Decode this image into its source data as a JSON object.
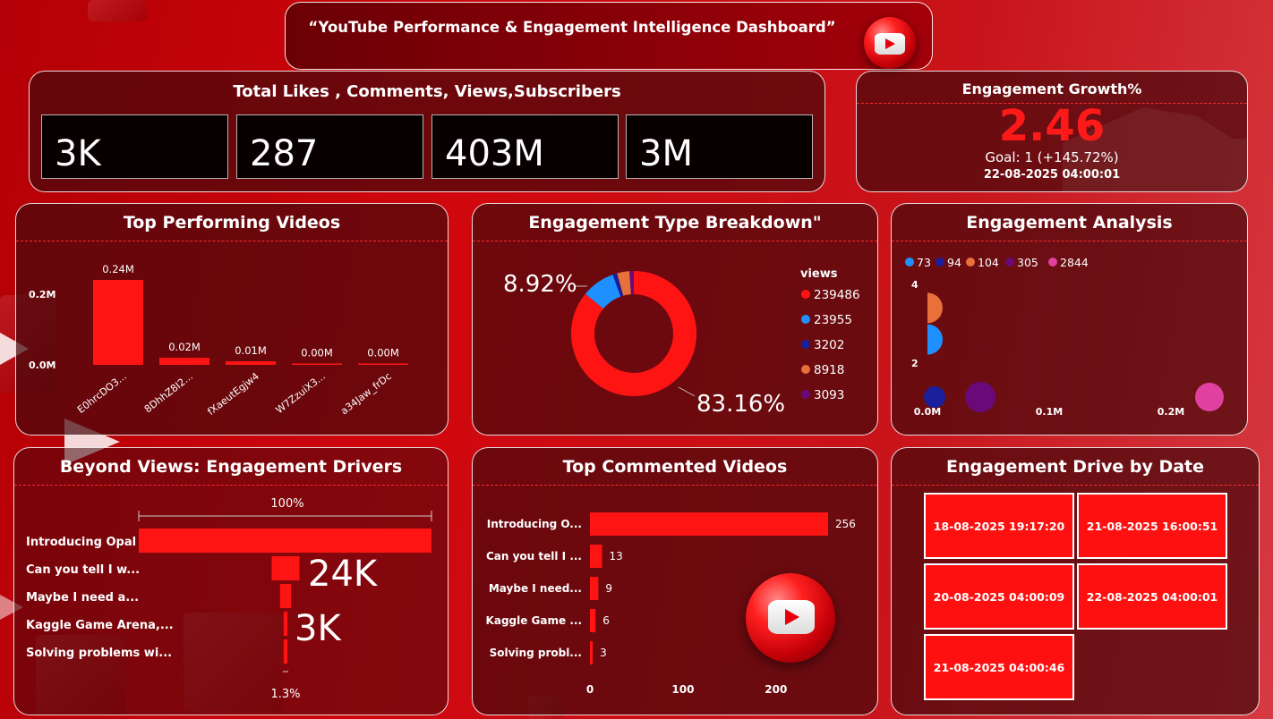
{
  "header": {
    "title": "“YouTube Performance & Engagement Intelligence Dashboard”"
  },
  "kpis": {
    "title": "Total Likes , Comments, Views,Subscribers",
    "values": [
      "3K",
      "287",
      "403M",
      "3M"
    ]
  },
  "growth": {
    "title": "Engagement Growth%",
    "value": "2.46",
    "goal": "Goal: 1 (+145.72%)",
    "timestamp": "22-08-2025 04:00:01"
  },
  "top_performing": {
    "title": "Top Performing Videos"
  },
  "engagement_type": {
    "title": "Engagement Type Breakdown\"",
    "legend_title": "views"
  },
  "engagement_analysis": {
    "title": "Engagement Analysis"
  },
  "beyond_views": {
    "title": "Beyond Views: Engagement Drivers"
  },
  "top_commented": {
    "title": "Top Commented Videos"
  },
  "by_date": {
    "title": "Engagement Drive by Date",
    "dates": [
      "18-08-2025 19:17:20",
      "21-08-2025 16:00:51",
      "20-08-2025 04:00:09",
      "22-08-2025 04:00:01",
      "21-08-2025 04:00:46"
    ]
  },
  "colors": {
    "accent": "#ff1010",
    "panel": "#46080c",
    "blue": "#1e90ff",
    "navy": "#1a1f9c",
    "orange": "#e8703a",
    "purple": "#6a0a7a",
    "pink": "#e040a0"
  },
  "chart_data": [
    {
      "type": "bar",
      "id": "top_performing",
      "categories": [
        "E0hrcDO3...",
        "8DhhZ8I2...",
        "fXaeutEgjw4",
        "W7ZzuiX3...",
        "a34Jaw_frDc"
      ],
      "values": [
        0.24,
        0.02,
        0.01,
        0.0,
        0.0
      ],
      "data_labels": [
        "0.24M",
        "0.02M",
        "0.01M",
        "0.00M",
        "0.00M"
      ],
      "ytick_labels": [
        "0.0M",
        "0.2M"
      ],
      "ylim": [
        0,
        0.24
      ]
    },
    {
      "type": "pie",
      "id": "engagement_type",
      "legend_title": "views",
      "labels": [
        "239486",
        "23955",
        "3202",
        "8918",
        "3093"
      ],
      "values": [
        239486,
        23955,
        3202,
        8918,
        3093
      ],
      "colors": [
        "#ff1414",
        "#1e90ff",
        "#1a1f9c",
        "#e8703a",
        "#6a0a7a"
      ],
      "data_labels": [
        "83.16%",
        "8.92%"
      ]
    },
    {
      "type": "scatter",
      "id": "engagement_analysis",
      "legend": [
        "73",
        "94",
        "104",
        "305",
        "2844"
      ],
      "colors": [
        "#1e90ff",
        "#1a1f9c",
        "#e8703a",
        "#6a0a7a",
        "#e040a0"
      ],
      "points": [
        {
          "series": "73",
          "x": 0.0,
          "y": 2.6
        },
        {
          "series": "94",
          "x": 0.0,
          "y": 1.0
        },
        {
          "series": "104",
          "x": 0.0,
          "y": 3.4
        },
        {
          "series": "305",
          "x": 0.02,
          "y": 1.0
        },
        {
          "series": "2844",
          "x": 0.24,
          "y": 1.0
        }
      ],
      "xtick_labels": [
        "0.0M",
        "0.1M",
        "0.2M"
      ],
      "ytick_labels": [
        "2",
        "4"
      ],
      "xlim": [
        0,
        0.2
      ],
      "ylim": [
        1,
        4
      ]
    },
    {
      "type": "bar",
      "id": "beyond_views",
      "orientation": "funnel",
      "categories": [
        "Introducing Opal",
        "Can you tell I w...",
        "Maybe I need a...",
        "Kaggle Game Arena,...",
        "Solving problems wi..."
      ],
      "values": [
        100,
        9.5,
        3.8,
        1.3,
        1.3
      ],
      "top_label": "100%",
      "bottom_label": "1.3%",
      "annotations": [
        "24K",
        "3K"
      ]
    },
    {
      "type": "bar",
      "id": "top_commented",
      "orientation": "horizontal",
      "categories": [
        "Introducing O...",
        "Can you tell I ...",
        "Maybe I need...",
        "Kaggle Game ...",
        "Solving probl..."
      ],
      "values": [
        256,
        13,
        9,
        6,
        3
      ],
      "xtick_labels": [
        "0",
        "100",
        "200"
      ],
      "xlim": [
        0,
        256
      ]
    }
  ]
}
